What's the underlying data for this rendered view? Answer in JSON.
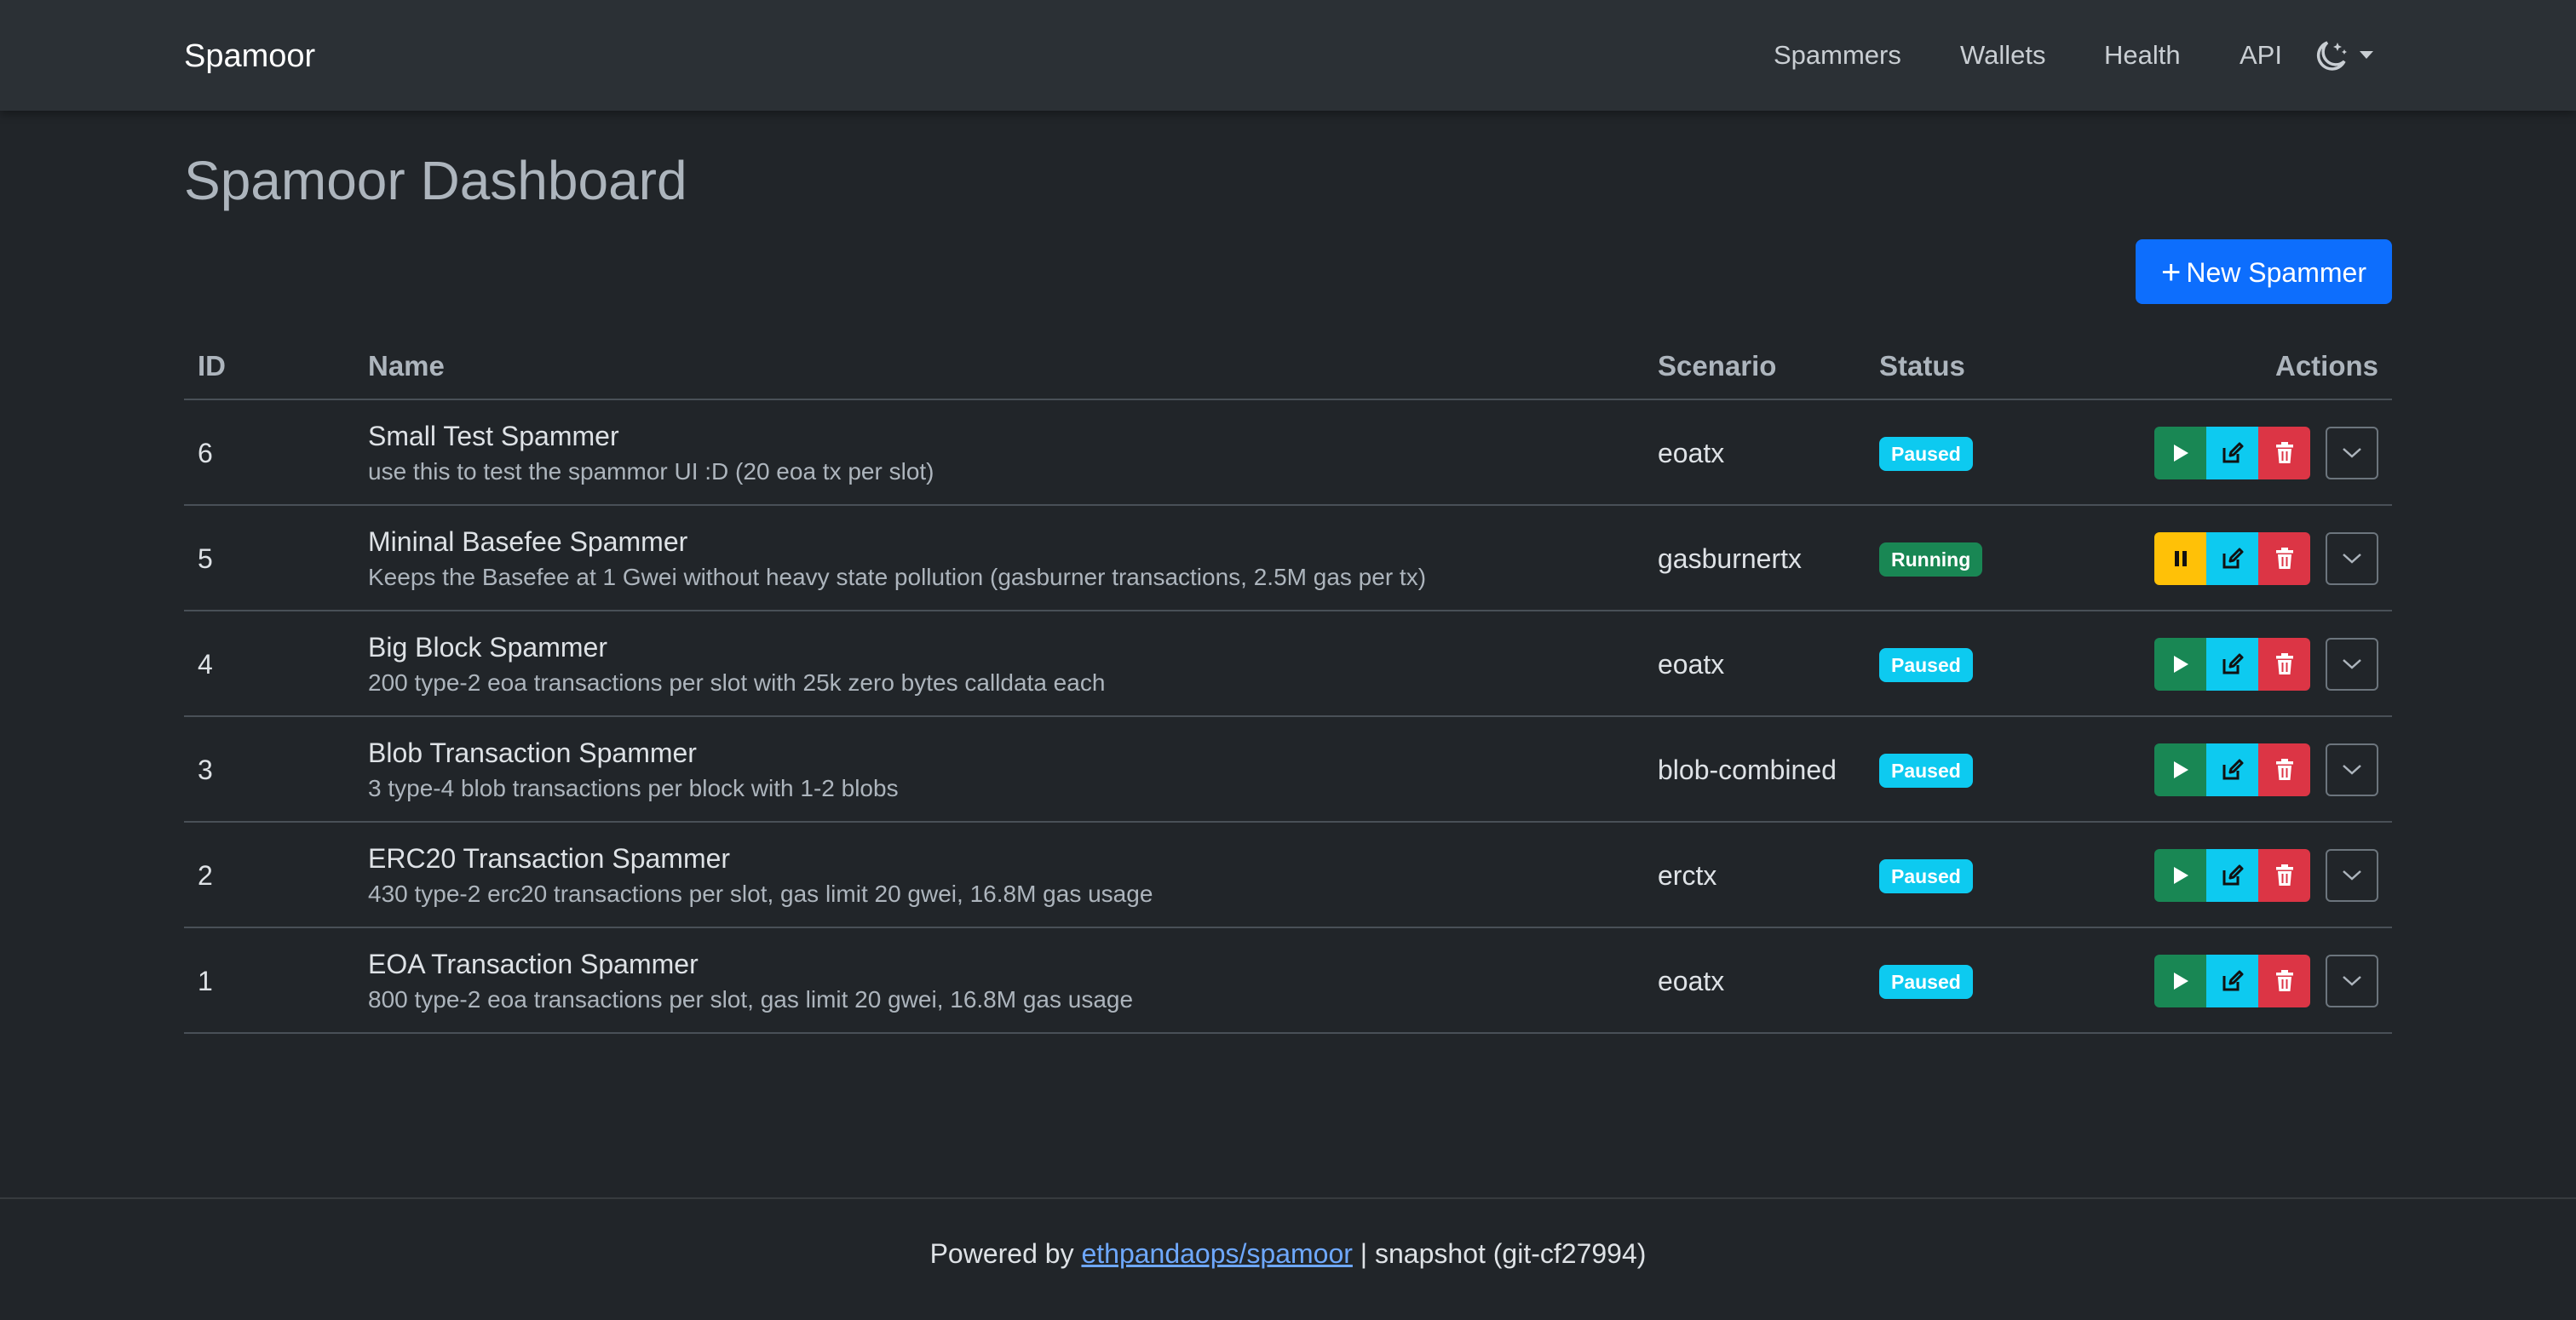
{
  "navbar": {
    "brand": "Spamoor",
    "links": [
      "Spammers",
      "Wallets",
      "Health",
      "API"
    ]
  },
  "page": {
    "title": "Spamoor Dashboard",
    "new_button_label": "New Spammer"
  },
  "table": {
    "headers": {
      "id": "ID",
      "name": "Name",
      "scenario": "Scenario",
      "status": "Status",
      "actions": "Actions"
    },
    "rows": [
      {
        "id": "6",
        "name": "Small Test Spammer",
        "description": "use this to test the spammor UI :D (20 eoa tx per slot)",
        "scenario": "eoatx",
        "status": "Paused"
      },
      {
        "id": "5",
        "name": "Mininal Basefee Spammer",
        "description": "Keeps the Basefee at 1 Gwei without heavy state pollution (gasburner transactions, 2.5M gas per tx)",
        "scenario": "gasburnertx",
        "status": "Running"
      },
      {
        "id": "4",
        "name": "Big Block Spammer",
        "description": "200 type-2 eoa transactions per slot with 25k zero bytes calldata each",
        "scenario": "eoatx",
        "status": "Paused"
      },
      {
        "id": "3",
        "name": "Blob Transaction Spammer",
        "description": "3 type-4 blob transactions per block with 1-2 blobs",
        "scenario": "blob-combined",
        "status": "Paused"
      },
      {
        "id": "2",
        "name": "ERC20 Transaction Spammer",
        "description": "430 type-2 erc20 transactions per slot, gas limit 20 gwei, 16.8M gas usage",
        "scenario": "erctx",
        "status": "Paused"
      },
      {
        "id": "1",
        "name": "EOA Transaction Spammer",
        "description": "800 type-2 eoa transactions per slot, gas limit 20 gwei, 16.8M gas usage",
        "scenario": "eoatx",
        "status": "Paused"
      }
    ]
  },
  "footer": {
    "prefix": "Powered by ",
    "link_text": "ethpandaops/spamoor",
    "suffix": " | snapshot (git-cf27994)"
  },
  "colors": {
    "background": "#212529",
    "navbar": "#2b3035",
    "primary": "#0d6efd",
    "success": "#198754",
    "info": "#0dcaf0",
    "warning": "#ffc107",
    "danger": "#dc3545"
  },
  "icons": {
    "theme": "moon-stars-icon",
    "play": "play-icon",
    "pause": "pause-icon",
    "edit": "edit-icon",
    "delete": "trash-icon",
    "expand": "chevron-down-icon",
    "add": "plus-icon"
  }
}
